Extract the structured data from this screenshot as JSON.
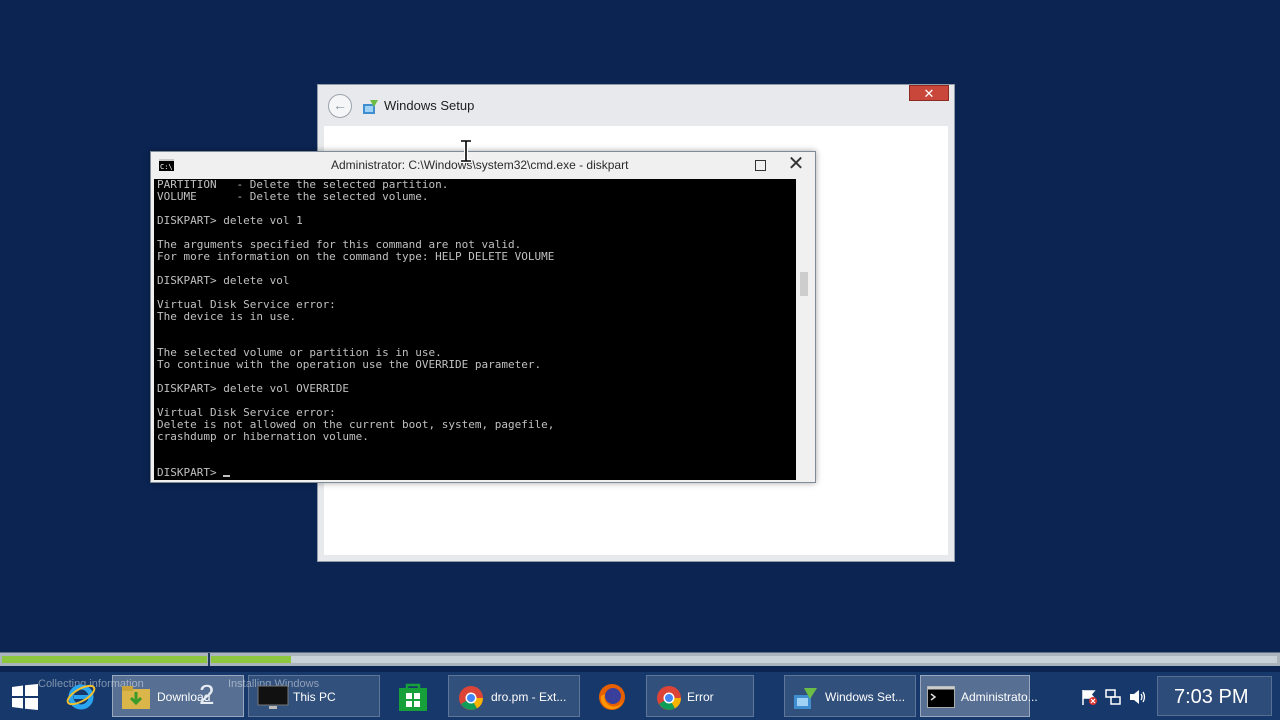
{
  "setup_window": {
    "title": "Windows Setup",
    "close_glyph": "✕",
    "back_glyph": "←"
  },
  "cmd_window": {
    "title": "Administrator: C:\\Windows\\system32\\cmd.exe - diskpart",
    "icon_text": "C:\\",
    "close_glyph": "✕",
    "lines": [
      "PARTITION   - Delete the selected partition.",
      "VOLUME      - Delete the selected volume.",
      "",
      "DISKPART> delete vol 1",
      "",
      "The arguments specified for this command are not valid.",
      "For more information on the command type: HELP DELETE VOLUME",
      "",
      "DISKPART> delete vol",
      "",
      "Virtual Disk Service error:",
      "The device is in use.",
      "",
      "",
      "The selected volume or partition is in use.",
      "To continue with the operation use the OVERRIDE parameter.",
      "",
      "DISKPART> delete vol OVERRIDE",
      "",
      "Virtual Disk Service error:",
      "Delete is not allowed on the current boot, system, pagefile,",
      "crashdump or hibernation volume.",
      "",
      ""
    ],
    "prompt": "DISKPART> "
  },
  "progress": {
    "step1_label": "Collecting information",
    "step2_label": "Installing Windows",
    "step2_fraction": 0.075
  },
  "taskbar": {
    "items": [
      {
        "label": "Download",
        "badge": "2",
        "icon": "folder-download-icon"
      },
      {
        "label": "This PC",
        "icon": "monitor-icon"
      },
      {
        "label": "dro.pm - Ext...",
        "icon": "chrome-icon"
      },
      {
        "label": "Error",
        "icon": "chrome-icon"
      },
      {
        "label": "Windows Set...",
        "icon": "setup-icon"
      },
      {
        "label": "Administrato...",
        "icon": "cmd-icon"
      }
    ],
    "clock": "7:03 PM"
  },
  "colors": {
    "desktop": "#0b2452",
    "taskbar": "#16386a",
    "progress_green": "#8dc63f"
  }
}
